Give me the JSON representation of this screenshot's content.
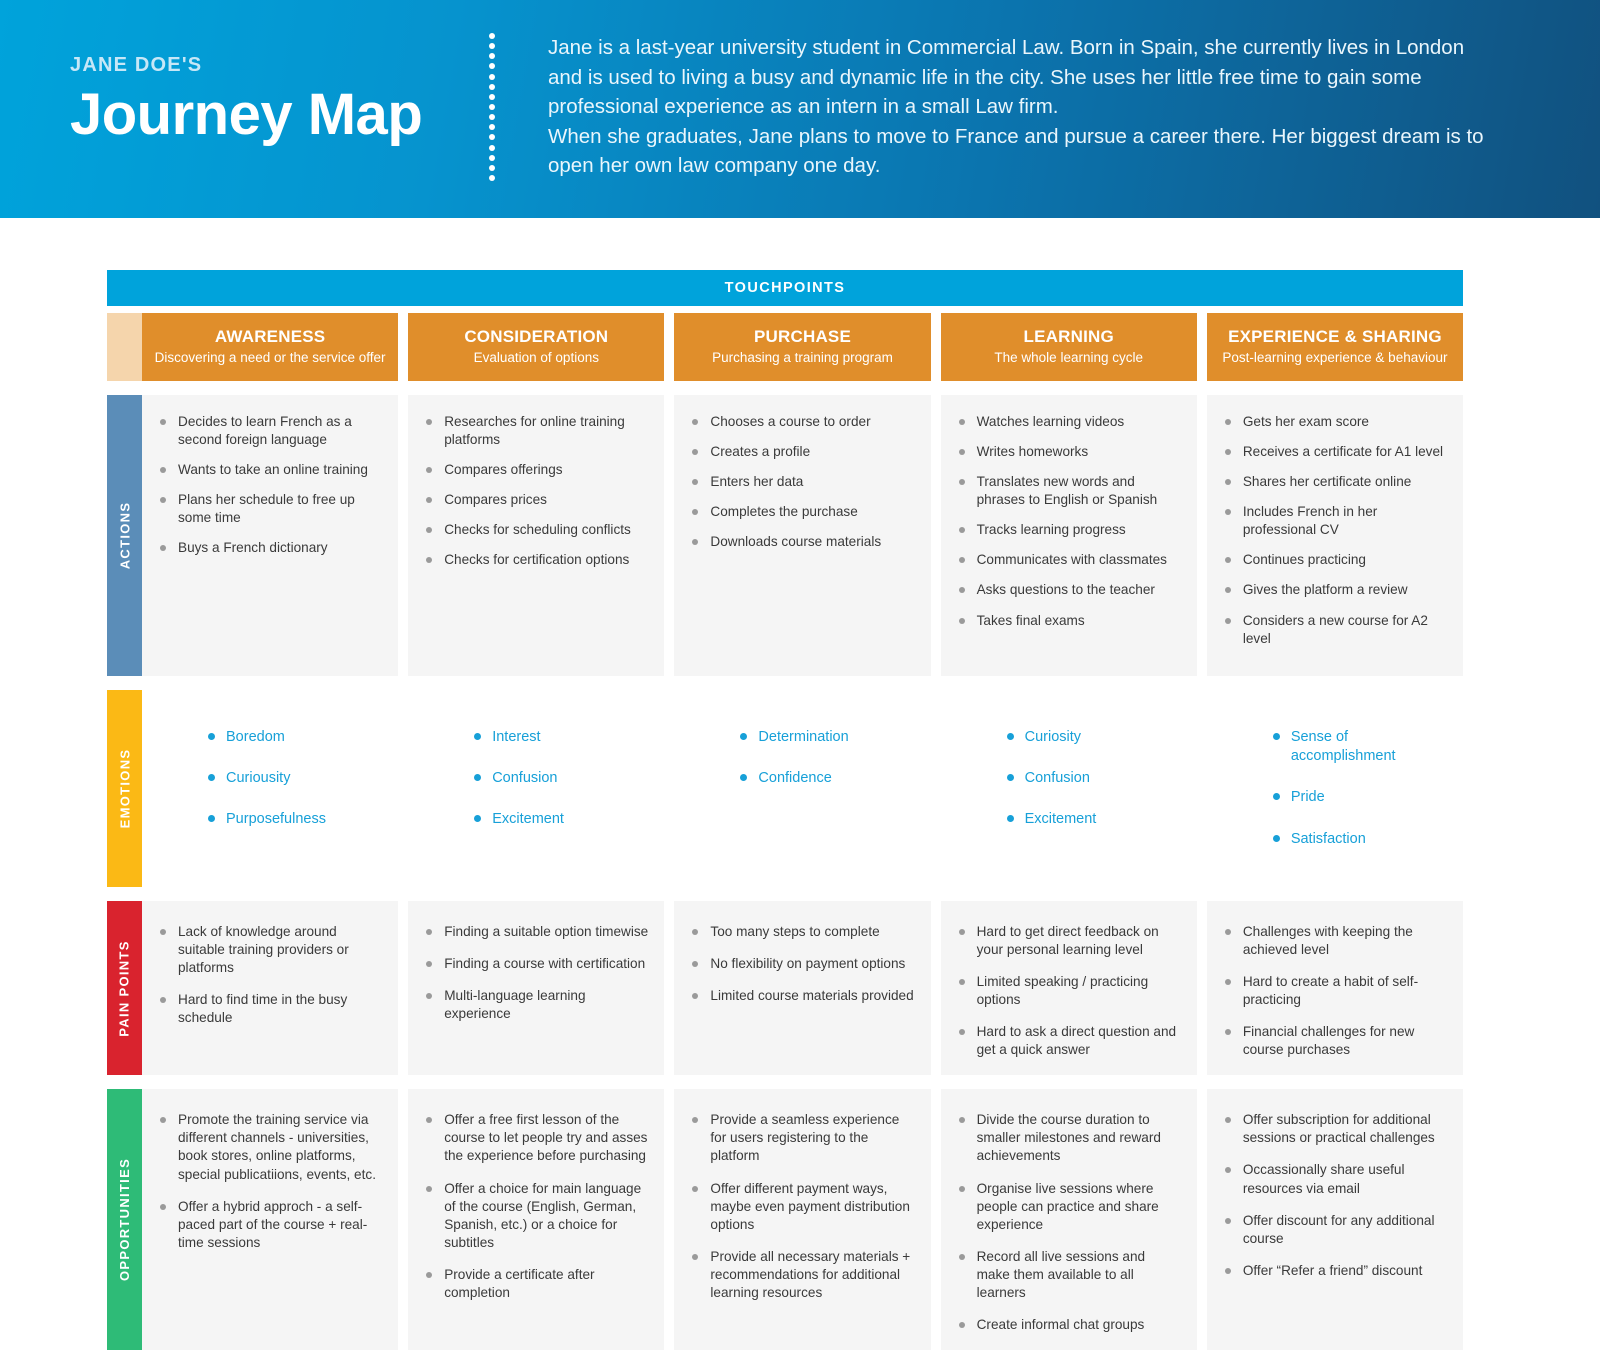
{
  "header": {
    "eyebrow": "JANE DOE'S",
    "title": "Journey Map",
    "bio_line_1": "Jane is a last-year university student in Commercial Law. Born in Spain, she currently lives in London and is used to living a busy and dynamic life in the city. She uses her little free time to gain some professional experience as an intern in a small Law firm.",
    "bio_line_2": "When she graduates, Jane plans to move to France and pursue a career there. Her biggest dream is to open her own law company one day."
  },
  "colors": {
    "header_start": "#00A3DB",
    "header_end": "#11517F",
    "touchpoints_bar": "#00A3DB",
    "stage_header": "#E08E2B",
    "stage_corner": "#F5D5AC",
    "actions_rail": "#5B8DB8",
    "emotions_rail": "#FBB915",
    "pain_rail": "#D9232E",
    "opportunities_rail": "#2EBB77",
    "emotion_text": "#17A0D8",
    "cell_background": "#F5F5F5",
    "body_text": "#3A3A3A",
    "bullet": "#9A9A9A"
  },
  "touchpoints_label": "TOUCHPOINTS",
  "stages": [
    {
      "name": "AWARENESS",
      "subtitle": "Discovering a need or the service offer"
    },
    {
      "name": "CONSIDERATION",
      "subtitle": "Evaluation of options"
    },
    {
      "name": "PURCHASE",
      "subtitle": "Purchasing a training program"
    },
    {
      "name": "LEARNING",
      "subtitle": "The whole learning cycle"
    },
    {
      "name": "EXPERIENCE & SHARING",
      "subtitle": "Post-learning experience & behaviour"
    }
  ],
  "rows": [
    {
      "label": "ACTIONS",
      "cells": [
        [
          "Decides to learn French as a second foreign language",
          "Wants to take an online training",
          "Plans her schedule to free up some time",
          "Buys a French dictionary"
        ],
        [
          "Researches for online training platforms",
          "Compares offerings",
          "Compares prices",
          "Checks for scheduling conflicts",
          "Checks for certification options"
        ],
        [
          "Chooses a course to order",
          "Creates a profile",
          "Enters her data",
          "Completes the purchase",
          "Downloads course materials"
        ],
        [
          "Watches learning videos",
          "Writes homeworks",
          "Translates new words and phrases to English or Spanish",
          "Tracks learning progress",
          "Communicates with classmates",
          "Asks questions to the teacher",
          "Takes final exams"
        ],
        [
          "Gets her exam score",
          "Receives a certificate for A1 level",
          "Shares her certificate online",
          "Includes French in her professional CV",
          "Continues practicing",
          "Gives the platform a review",
          "Considers a new course for A2 level"
        ]
      ]
    },
    {
      "label": "EMOTIONS",
      "cells": [
        [
          "Boredom",
          "Curiousity",
          "Purposefulness"
        ],
        [
          "Interest",
          "Confusion",
          "Excitement"
        ],
        [
          "Determination",
          "Confidence"
        ],
        [
          "Curiosity",
          "Confusion",
          "Excitement"
        ],
        [
          "Sense of accomplishment",
          "Pride",
          "Satisfaction"
        ]
      ]
    },
    {
      "label": "PAIN POINTS",
      "cells": [
        [
          "Lack of knowledge around suitable training providers or platforms",
          "Hard to find time in the busy schedule"
        ],
        [
          "Finding a suitable option timewise",
          "Finding a course with certification",
          "Multi-language learning experience"
        ],
        [
          "Too many steps to complete",
          "No flexibility on payment options",
          "Limited course materials provided"
        ],
        [
          "Hard to get direct feedback on your personal learning level",
          "Limited speaking / practicing options",
          "Hard to ask a direct question and get a quick answer"
        ],
        [
          "Challenges with keeping the achieved level",
          "Hard to create a habit of self-practicing",
          "Financial challenges for new course purchases"
        ]
      ]
    },
    {
      "label": "OPPORTUNITIES",
      "cells": [
        [
          "Promote the training service via different channels - universities, book stores, online platforms, special publicatiions, events, etc.",
          "Offer a hybrid approch - a self-paced part of the course + real-time sessions"
        ],
        [
          "Offer a free first lesson of the course to let people try and asses the experience before purchasing",
          "Offer a choice for main language of the course (English, German, Spanish, etc.) or a choice for subtitles",
          "Provide a certificate after completion"
        ],
        [
          "Provide a seamless experience for users registering to the platform",
          "Offer different payment ways, maybe even payment distribution options",
          "Provide all necessary materials + recommendations for additional learning resources"
        ],
        [
          "Divide the course duration to smaller milestones and reward achievements",
          "Organise live sessions where people can practice and share experience",
          "Record all live sessions and make them available to all learners",
          "Create informal chat groups"
        ],
        [
          "Offer subscription for additional sessions or practical challenges",
          "Occassionally share useful resources via email",
          "Offer discount for any additional course",
          "Offer “Refer a friend” discount"
        ]
      ]
    }
  ]
}
